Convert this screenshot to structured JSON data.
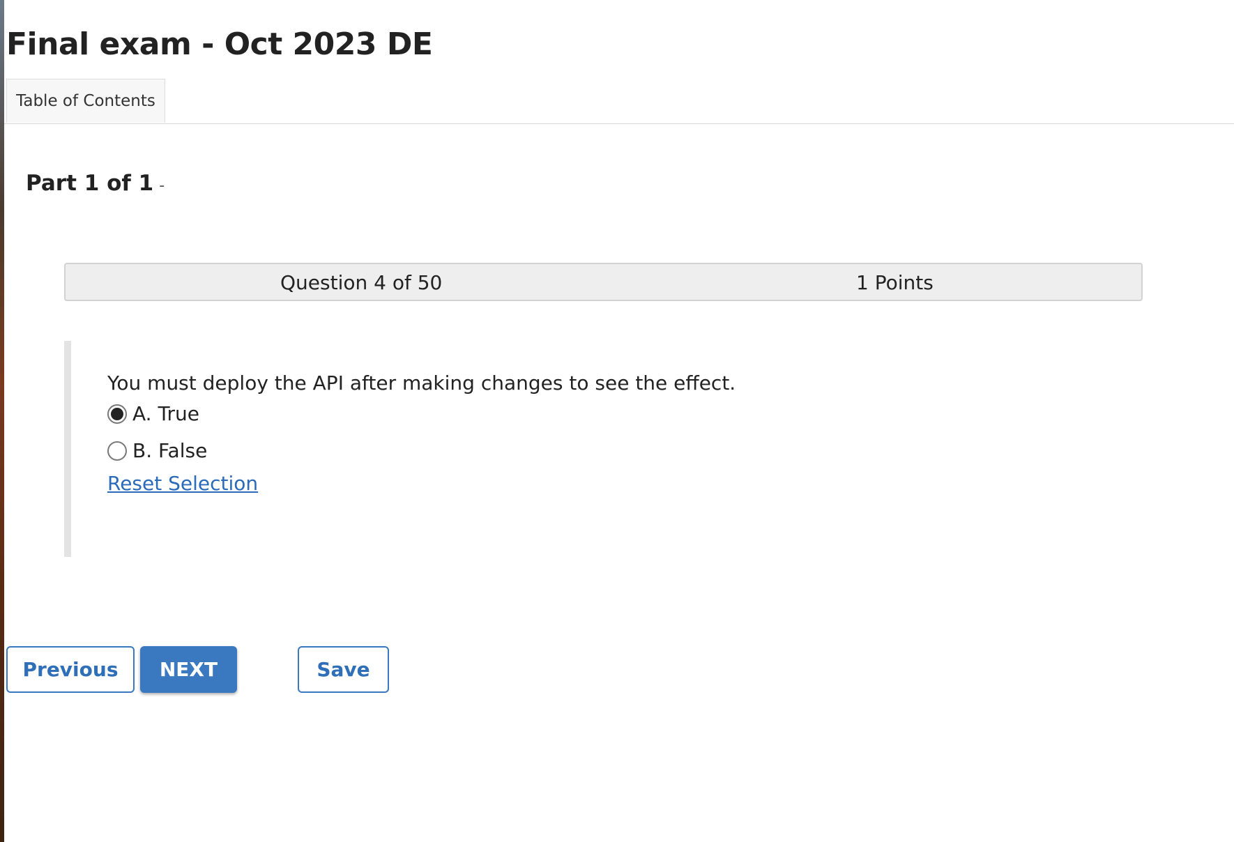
{
  "exam": {
    "title": "Final exam - Oct 2023 DE"
  },
  "tabs": {
    "table_of_contents": "Table of Contents"
  },
  "part": {
    "heading": "Part 1 of 1",
    "dash": "-"
  },
  "question": {
    "number_label": "Question 4 of 50",
    "points_label": "1 Points",
    "text": "You must deploy the API after making changes to see the effect.",
    "options": [
      {
        "label": "A. True",
        "selected": true
      },
      {
        "label": "B. False",
        "selected": false
      }
    ],
    "reset_label": "Reset Selection"
  },
  "navigation": {
    "previous_label": "Previous",
    "next_label": "NEXT",
    "save_label": "Save"
  },
  "colors": {
    "accent": "#3a78c0",
    "link": "#2a6ab8",
    "question_bar_bg": "#eeeeee",
    "text": "#222222"
  },
  "icons": {
    "selected_radio": "radio-selected-icon",
    "unselected_radio": "radio-unselected-icon"
  }
}
